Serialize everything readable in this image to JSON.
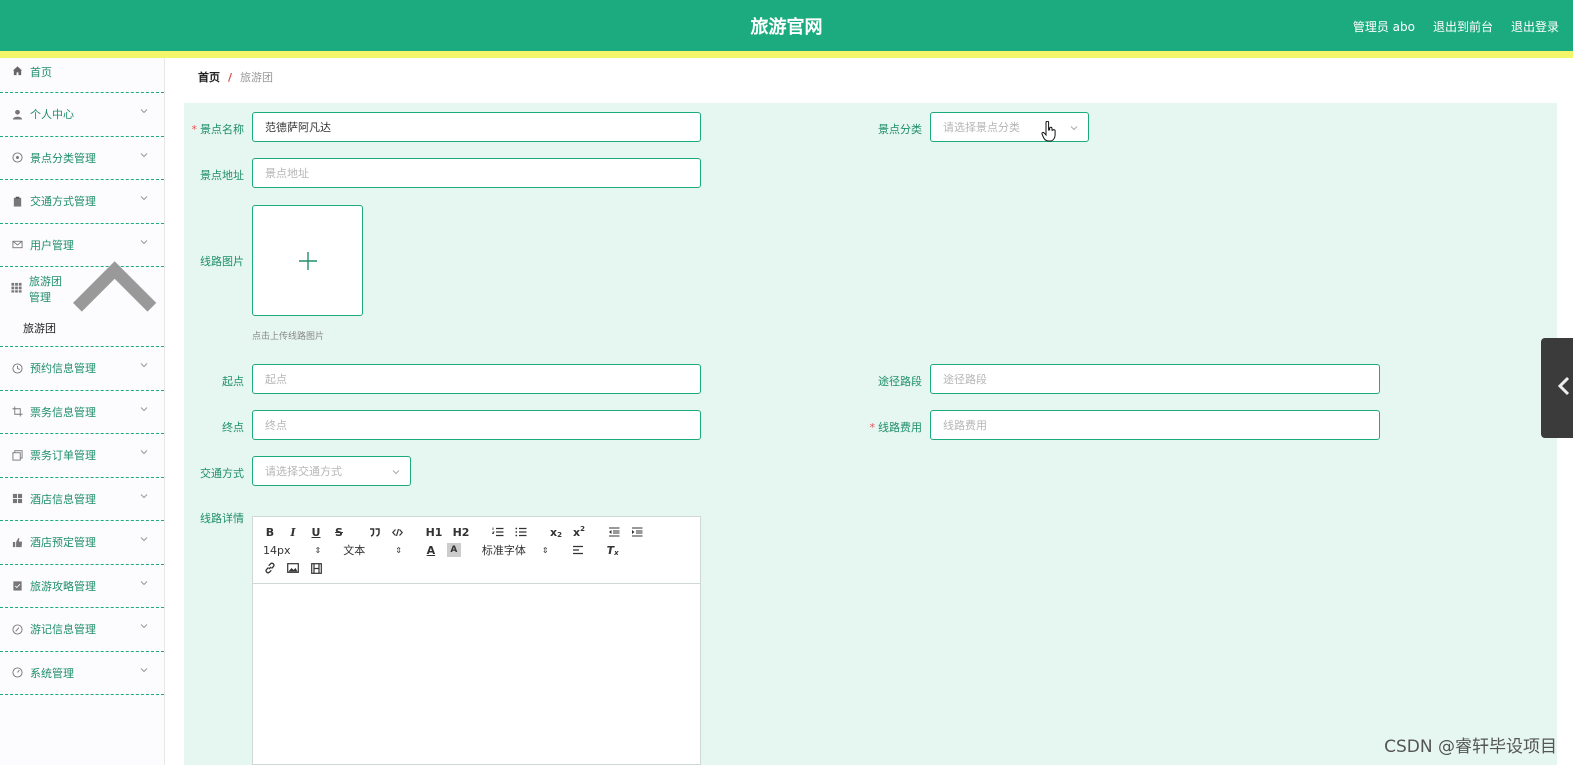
{
  "header": {
    "title": "旅游官网",
    "admin_label": "管理员 abo",
    "to_front_label": "退出到前台",
    "logout_label": "退出登录"
  },
  "sidebar": {
    "home": "首页",
    "items": [
      {
        "label": "个人中心",
        "icon": "user-icon"
      },
      {
        "label": "景点分类管理",
        "icon": "compass-icon"
      },
      {
        "label": "交通方式管理",
        "icon": "clipboard-icon"
      },
      {
        "label": "用户管理",
        "icon": "mail-icon"
      }
    ],
    "open_group": {
      "label": "旅游团管理",
      "icon": "grid-icon",
      "child": "旅游团"
    },
    "items_after": [
      {
        "label": "预约信息管理",
        "icon": "clock-icon"
      },
      {
        "label": "票务信息管理",
        "icon": "crop-icon"
      },
      {
        "label": "票务订单管理",
        "icon": "copy-icon"
      },
      {
        "label": "酒店信息管理",
        "icon": "apps-icon"
      },
      {
        "label": "酒店预定管理",
        "icon": "thumb-icon"
      },
      {
        "label": "旅游攻略管理",
        "icon": "checklist-icon"
      },
      {
        "label": "游记信息管理",
        "icon": "disc-icon"
      },
      {
        "label": "系统管理",
        "icon": "dial-icon"
      }
    ]
  },
  "breadcrumb": {
    "home": "首页",
    "separator": "/",
    "current": "旅游团"
  },
  "form": {
    "spot_name": {
      "label": "景点名称",
      "value": "范德萨阿凡达",
      "required": true
    },
    "spot_category": {
      "label": "景点分类",
      "placeholder": "请选择景点分类"
    },
    "spot_address": {
      "label": "景点地址",
      "placeholder": "景点地址"
    },
    "route_image": {
      "label": "线路图片",
      "hint": "点击上传线路图片"
    },
    "start_point": {
      "label": "起点",
      "placeholder": "起点"
    },
    "via_route": {
      "label": "途径路段",
      "placeholder": "途径路段"
    },
    "end_point": {
      "label": "终点",
      "placeholder": "终点"
    },
    "route_fee": {
      "label": "线路费用",
      "placeholder": "线路费用",
      "required": true
    },
    "transport": {
      "label": "交通方式",
      "placeholder": "请选择交通方式"
    },
    "route_detail": {
      "label": "线路详情"
    }
  },
  "editor": {
    "font_size": "14px",
    "text_style": "文本",
    "font_family": "标准字体",
    "h1": "H1",
    "h2": "H2"
  },
  "watermark": "CSDN @睿轩毕设项目",
  "colors": {
    "primary": "#1cab7e",
    "accent_strip": "#f3f56b",
    "form_bg": "#e6f6f0"
  }
}
